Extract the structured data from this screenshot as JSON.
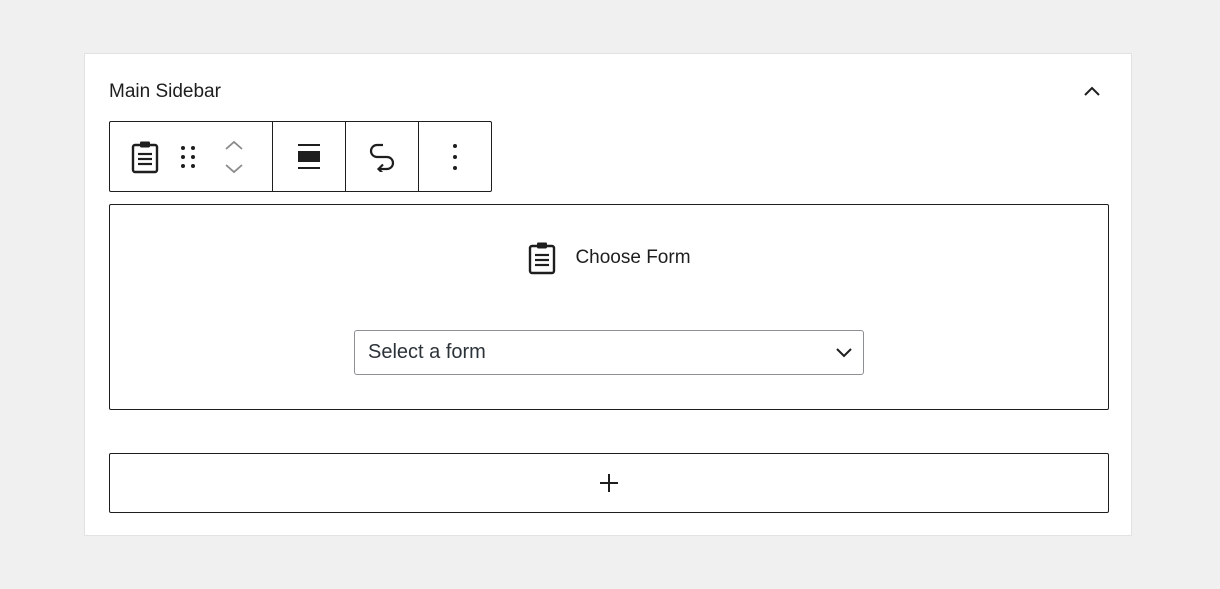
{
  "panel": {
    "title": "Main Sidebar",
    "collapse_icon": "chevron-up-icon"
  },
  "toolbar": {
    "block_icon": "clipboard-form-icon",
    "drag_icon": "drag-handle-icon",
    "move_up_icon": "chevron-up-icon",
    "move_down_icon": "chevron-down-icon",
    "align_icon": "align-wide-icon",
    "transform_icon": "transform-arrow-icon",
    "more_icon": "more-vertical-icon"
  },
  "form_block": {
    "icon": "clipboard-form-icon",
    "heading": "Choose Form",
    "select": {
      "selected": "Select a form",
      "chevron_icon": "chevron-down-icon"
    }
  },
  "appender": {
    "icon": "plus-icon"
  },
  "colors": {
    "background": "#f0f0f0",
    "panel": "#ffffff",
    "border_dark": "#1e1e1e",
    "select_border": "#8c8f94"
  }
}
